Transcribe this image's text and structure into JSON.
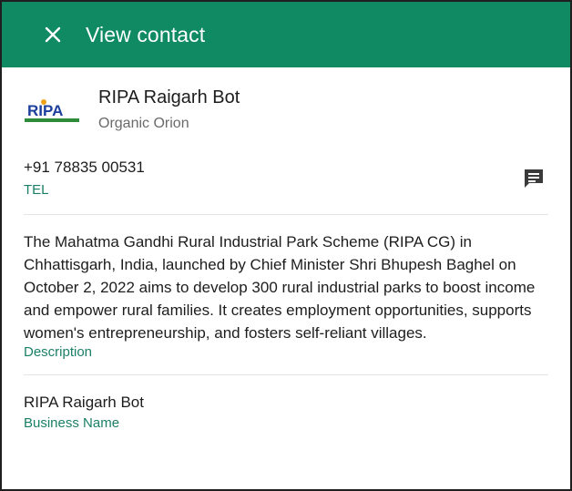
{
  "header": {
    "title": "View contact",
    "bg_color": "#0f8a63"
  },
  "profile": {
    "name": "RIPA Raigarh Bot",
    "subtitle": "Organic Orion",
    "logo_text": "RIPA"
  },
  "phone": {
    "number": "+91 78835 00531",
    "label": "TEL",
    "action_icon": "message-icon"
  },
  "description": {
    "text": "The Mahatma Gandhi Rural Industrial Park Scheme (RIPA CG) in Chhattisgarh, India, launched by Chief Minister Shri Bhupesh Baghel on October 2, 2022 aims to develop 300 rural industrial parks to boost income and empower rural families. It creates employment opportunities, supports women's entrepreneurship, and fosters self-reliant villages.",
    "label": "Description"
  },
  "business": {
    "name": "RIPA Raigarh Bot",
    "label": "Business Name"
  },
  "colors": {
    "accent": "#0f8a63",
    "label_green": "#1a7f66"
  }
}
